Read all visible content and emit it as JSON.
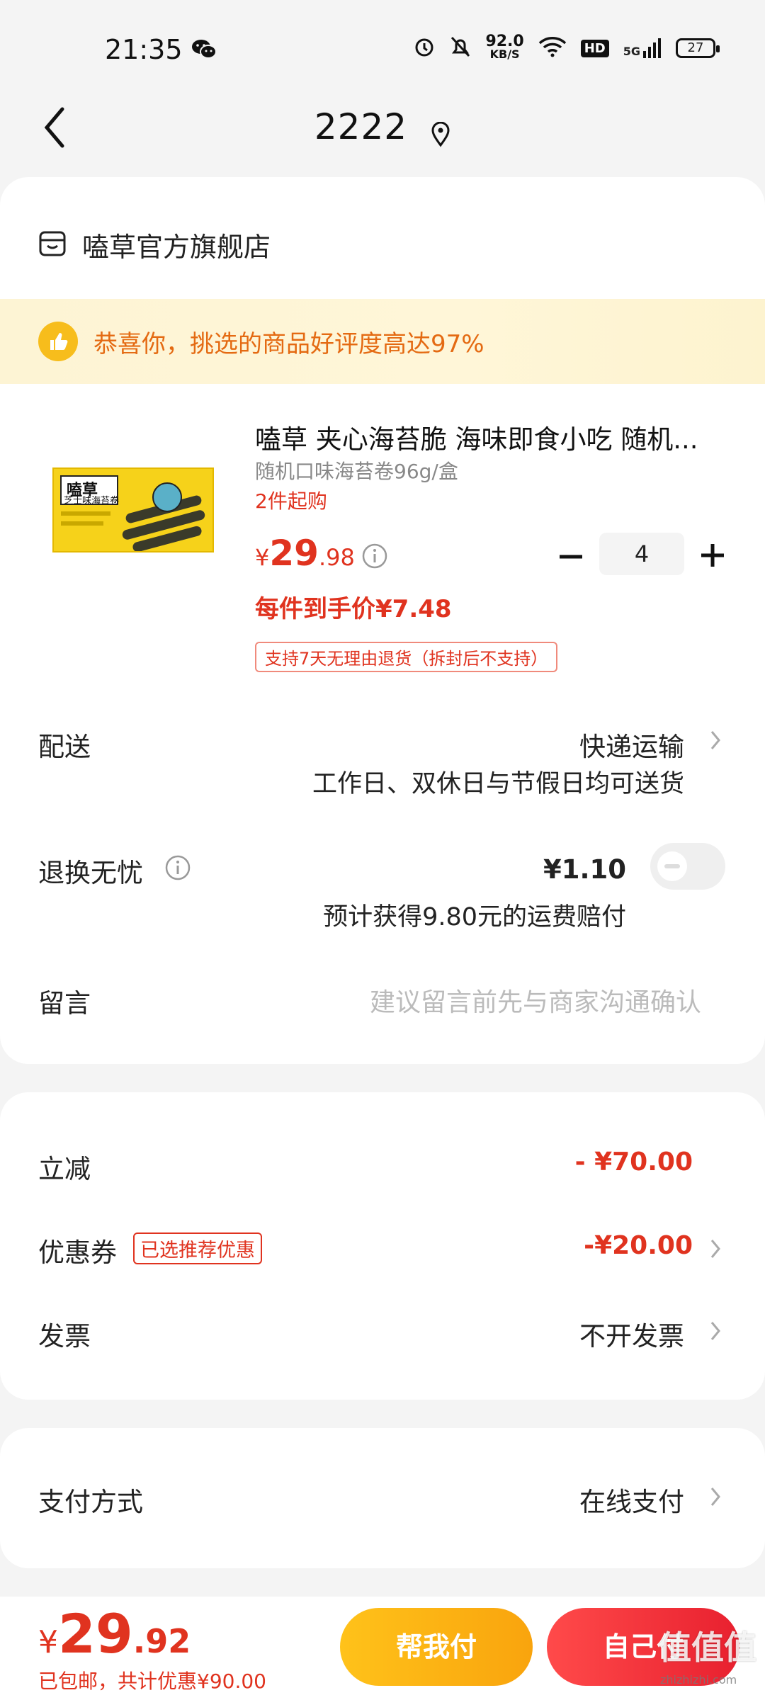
{
  "status_bar": {
    "time": "21:35",
    "net_speed_value": "92.0",
    "net_speed_unit": "KB/S",
    "hd": "HD",
    "signal": "5G",
    "battery": "27"
  },
  "header": {
    "title": "2222"
  },
  "store": {
    "name": "嗑草官方旗舰店"
  },
  "praise": {
    "text": "恭喜你，挑选的商品好评度高达97%"
  },
  "product": {
    "title": "嗑草 夹心海苔脆 海味即食小吃 随机...",
    "spec": "随机口味海苔卷96g/盒",
    "min_order": "2件起购",
    "price_currency": "¥",
    "price_int": "29",
    "price_dec": ".98",
    "quantity": "4",
    "unit_price": "每件到手价¥7.48",
    "return_policy": "支持7天无理由退货（拆封后不支持）",
    "image_brand": "嗑草",
    "image_sub": "芝士味海苔卷"
  },
  "delivery": {
    "label": "配送",
    "value": "快递运输",
    "sub": "工作日、双休日与节假日均可送货"
  },
  "return_insurance": {
    "label": "退换无忧",
    "price": "¥1.10",
    "sub": "预计获得9.80元的运费赔付"
  },
  "message": {
    "label": "留言",
    "placeholder": "建议留言前先与商家沟通确认"
  },
  "discount": {
    "label": "立减",
    "value": "- ¥70.00"
  },
  "coupon": {
    "label": "优惠券",
    "tag": "已选推荐优惠",
    "value": "-¥20.00"
  },
  "invoice": {
    "label": "发票",
    "value": "不开发票"
  },
  "payment": {
    "label": "支付方式",
    "value": "在线支付"
  },
  "footer": {
    "total_currency": "¥",
    "total_int": "29",
    "total_dec": ".92",
    "summary": "已包邮，共计优惠¥90.00",
    "help_pay": "帮我付",
    "self_pay": "自己付",
    "watermark": "值值值",
    "watermark_sub": "zhizhizhi.com"
  },
  "colors": {
    "accent_red": "#e0331f",
    "accent_orange": "#e46a12",
    "help_button": "#ffc21a",
    "self_button": "#e8202f"
  }
}
